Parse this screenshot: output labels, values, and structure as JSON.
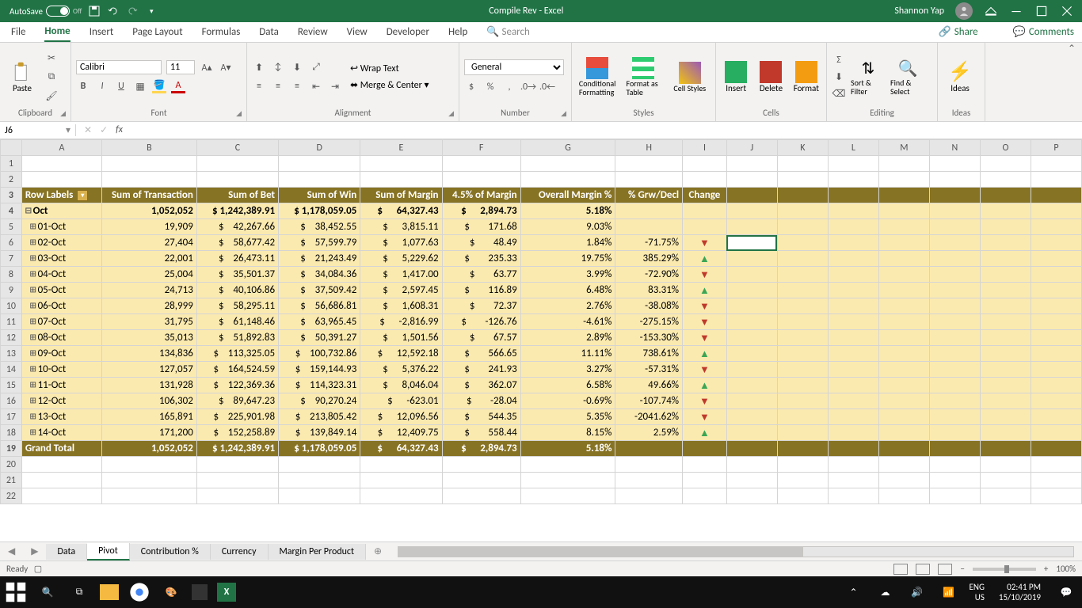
{
  "titlebar": {
    "autosave": "AutoSave",
    "autosave_state": "Off",
    "title": "Compile Rev  -  Excel",
    "user": "Shannon Yap"
  },
  "tabs": {
    "file": "File",
    "home": "Home",
    "insert": "Insert",
    "pagelayout": "Page Layout",
    "formulas": "Formulas",
    "data": "Data",
    "review": "Review",
    "view": "View",
    "developer": "Developer",
    "help": "Help",
    "search": "Search",
    "share": "Share",
    "comments": "Comments"
  },
  "ribbon": {
    "clipboard": {
      "paste": "Paste",
      "label": "Clipboard"
    },
    "font": {
      "name": "Calibri",
      "size": "11",
      "label": "Font"
    },
    "alignment": {
      "wrap": "Wrap Text",
      "merge": "Merge & Center",
      "label": "Alignment"
    },
    "number": {
      "format": "General",
      "label": "Number"
    },
    "styles": {
      "cond": "Conditional Formatting",
      "table": "Format as Table",
      "cell": "Cell Styles",
      "label": "Styles"
    },
    "cells": {
      "insert": "Insert",
      "delete": "Delete",
      "format": "Format",
      "label": "Cells"
    },
    "editing": {
      "sort": "Sort & Filter",
      "find": "Find & Select",
      "label": "Editing"
    },
    "ideas": {
      "btn": "Ideas",
      "label": "Ideas"
    }
  },
  "namebox": "J6",
  "columns": [
    "A",
    "B",
    "C",
    "D",
    "E",
    "F",
    "G",
    "H",
    "I",
    "J",
    "K",
    "L",
    "M",
    "N",
    "O",
    "P"
  ],
  "headers": {
    "rowlabels": "Row Labels",
    "transaction": "Sum of Transaction",
    "bet": "Sum of Bet",
    "win": "Sum of Win",
    "margin": "Sum of Margin",
    "pct45": "4.5% of Margin",
    "overall": "Overall Margin %",
    "grw": "% Grw/Decl",
    "change": "Change"
  },
  "oct": {
    "label": "Oct",
    "trans": "1,052,052",
    "bet": "1,242,389.91",
    "win": "1,178,059.05",
    "margin": "64,327.43",
    "pct45": "2,894.73",
    "overall": "5.18%"
  },
  "rows": [
    {
      "label": "01-Oct",
      "trans": "19,909",
      "bet": "42,267.66",
      "win": "38,452.55",
      "margin": "3,815.11",
      "pct45": "171.68",
      "overall": "9.03%",
      "grw": "",
      "dir": ""
    },
    {
      "label": "02-Oct",
      "trans": "27,404",
      "bet": "58,677.42",
      "win": "57,599.79",
      "margin": "1,077.63",
      "pct45": "48.49",
      "overall": "1.84%",
      "grw": "-71.75%",
      "dir": "down"
    },
    {
      "label": "03-Oct",
      "trans": "22,001",
      "bet": "26,473.11",
      "win": "21,243.49",
      "margin": "5,229.62",
      "pct45": "235.33",
      "overall": "19.75%",
      "grw": "385.29%",
      "dir": "up"
    },
    {
      "label": "04-Oct",
      "trans": "25,004",
      "bet": "35,501.37",
      "win": "34,084.36",
      "margin": "1,417.00",
      "pct45": "63.77",
      "overall": "3.99%",
      "grw": "-72.90%",
      "dir": "down"
    },
    {
      "label": "05-Oct",
      "trans": "24,713",
      "bet": "40,106.86",
      "win": "37,509.42",
      "margin": "2,597.45",
      "pct45": "116.89",
      "overall": "6.48%",
      "grw": "83.31%",
      "dir": "up"
    },
    {
      "label": "06-Oct",
      "trans": "28,999",
      "bet": "58,295.11",
      "win": "56,686.81",
      "margin": "1,608.31",
      "pct45": "72.37",
      "overall": "2.76%",
      "grw": "-38.08%",
      "dir": "down"
    },
    {
      "label": "07-Oct",
      "trans": "31,795",
      "bet": "61,148.46",
      "win": "63,965.45",
      "margin": "-2,816.99",
      "pct45": "-126.76",
      "overall": "-4.61%",
      "grw": "-275.15%",
      "dir": "down"
    },
    {
      "label": "08-Oct",
      "trans": "35,013",
      "bet": "51,892.83",
      "win": "50,391.27",
      "margin": "1,501.56",
      "pct45": "67.57",
      "overall": "2.89%",
      "grw": "-153.30%",
      "dir": "down"
    },
    {
      "label": "09-Oct",
      "trans": "134,836",
      "bet": "113,325.05",
      "win": "100,732.86",
      "margin": "12,592.18",
      "pct45": "566.65",
      "overall": "11.11%",
      "grw": "738.61%",
      "dir": "up"
    },
    {
      "label": "10-Oct",
      "trans": "127,057",
      "bet": "164,524.59",
      "win": "159,144.93",
      "margin": "5,376.22",
      "pct45": "241.93",
      "overall": "3.27%",
      "grw": "-57.31%",
      "dir": "down"
    },
    {
      "label": "11-Oct",
      "trans": "131,928",
      "bet": "122,369.36",
      "win": "114,323.31",
      "margin": "8,046.04",
      "pct45": "362.07",
      "overall": "6.58%",
      "grw": "49.66%",
      "dir": "up"
    },
    {
      "label": "12-Oct",
      "trans": "106,302",
      "bet": "89,647.23",
      "win": "90,270.24",
      "margin": "-623.01",
      "pct45": "-28.04",
      "overall": "-0.69%",
      "grw": "-107.74%",
      "dir": "down"
    },
    {
      "label": "13-Oct",
      "trans": "165,891",
      "bet": "225,901.98",
      "win": "213,805.42",
      "margin": "12,096.56",
      "pct45": "544.35",
      "overall": "5.35%",
      "grw": "-2041.62%",
      "dir": "down"
    },
    {
      "label": "14-Oct",
      "trans": "171,200",
      "bet": "152,258.89",
      "win": "139,849.14",
      "margin": "12,409.75",
      "pct45": "558.44",
      "overall": "8.15%",
      "grw": "2.59%",
      "dir": "up"
    }
  ],
  "total": {
    "label": "Grand Total",
    "trans": "1,052,052",
    "bet": "1,242,389.91",
    "win": "1,178,059.05",
    "margin": "64,327.43",
    "pct45": "2,894.73",
    "overall": "5.18%"
  },
  "sheets": {
    "data": "Data",
    "pivot": "Pivot",
    "contrib": "Contribution %",
    "currency": "Currency",
    "margin": "Margin Per Product"
  },
  "status": {
    "ready": "Ready",
    "zoom": "100%"
  },
  "taskbar": {
    "lang1": "ENG",
    "lang2": "US",
    "time": "02:41 PM",
    "date": "15/10/2019"
  }
}
